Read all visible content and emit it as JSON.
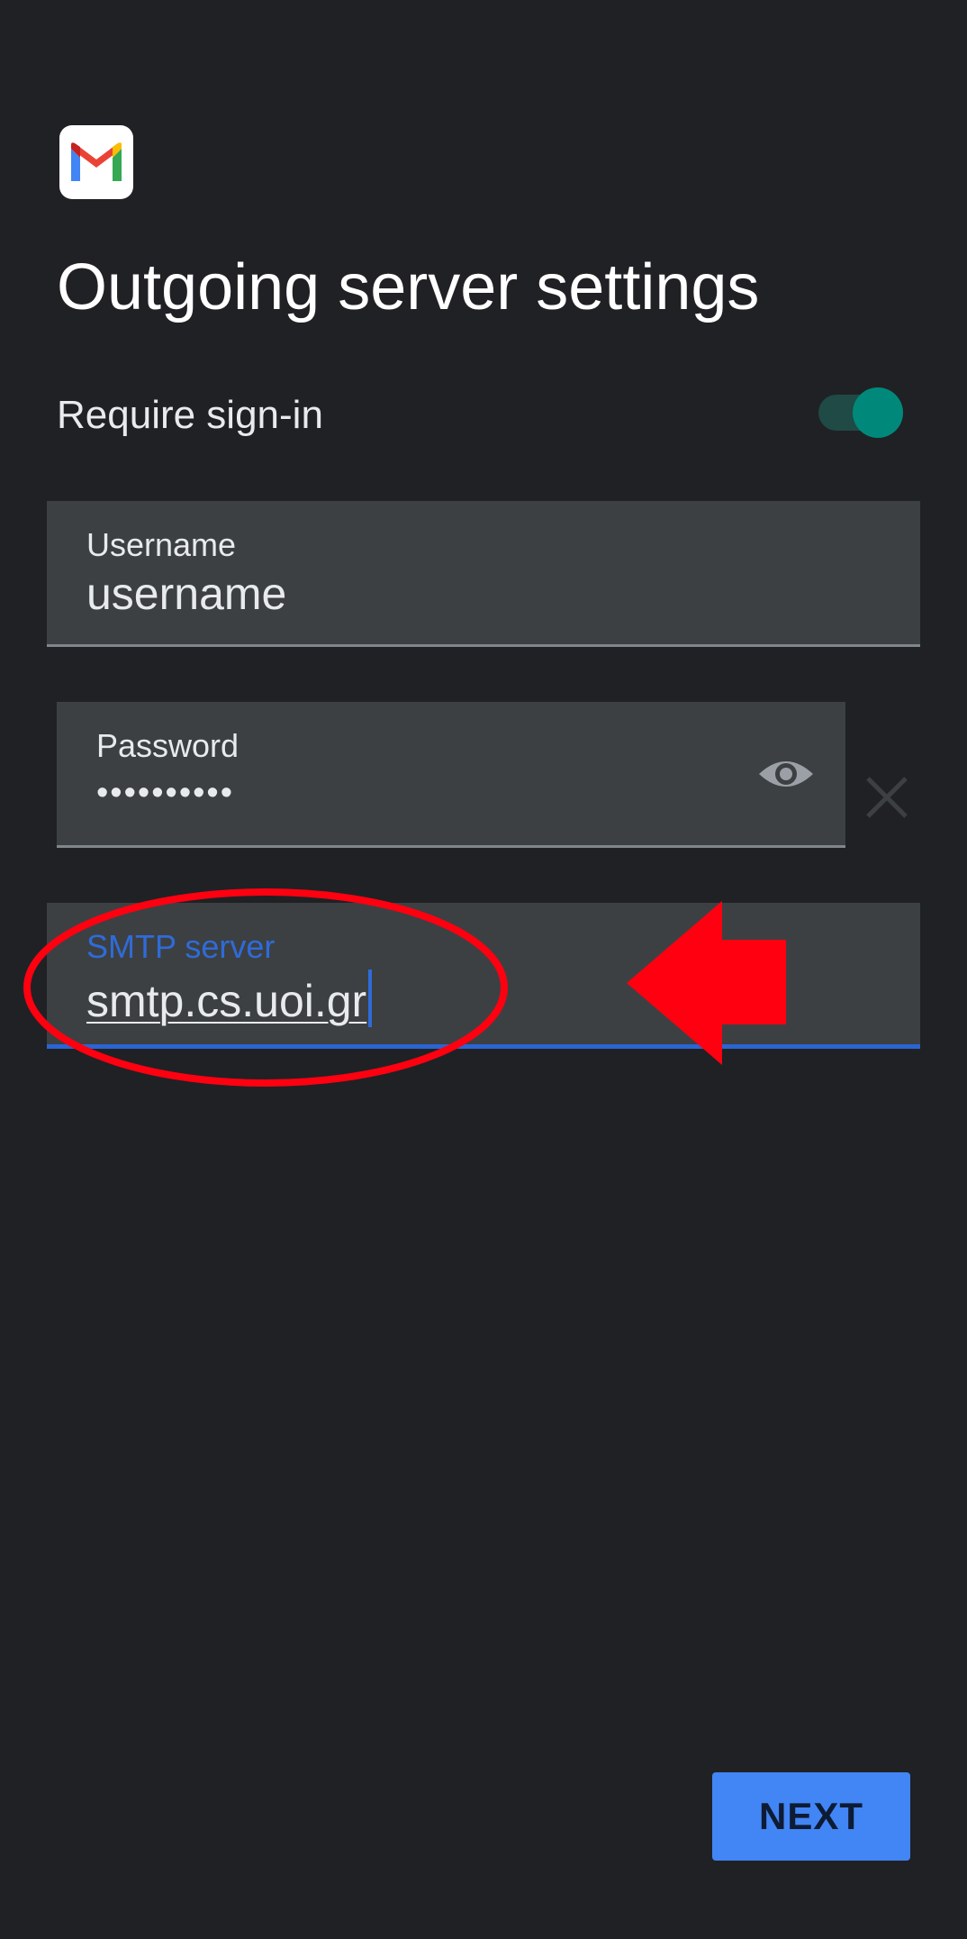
{
  "app": {
    "name": "Gmail",
    "logo_icon": "gmail-m-icon"
  },
  "header": {
    "title": "Outgoing server settings"
  },
  "sign_in": {
    "label": "Require sign-in",
    "enabled": true,
    "accent_color": "#00897b"
  },
  "fields": {
    "username": {
      "label": "Username",
      "value": "username"
    },
    "password": {
      "label": "Password",
      "value": "••••••••••",
      "toggle_icon": "eye-icon",
      "clear_icon": "close-icon"
    },
    "smtp": {
      "label": "SMTP server",
      "value": "smtp.cs.uoi.gr",
      "focused": true,
      "focus_color": "#2f6bd8"
    }
  },
  "annotation": {
    "color": "#ff0010",
    "shapes": [
      "ellipse-highlight",
      "left-arrow"
    ]
  },
  "footer": {
    "next_label": "NEXT",
    "button_color": "#4285f4"
  }
}
